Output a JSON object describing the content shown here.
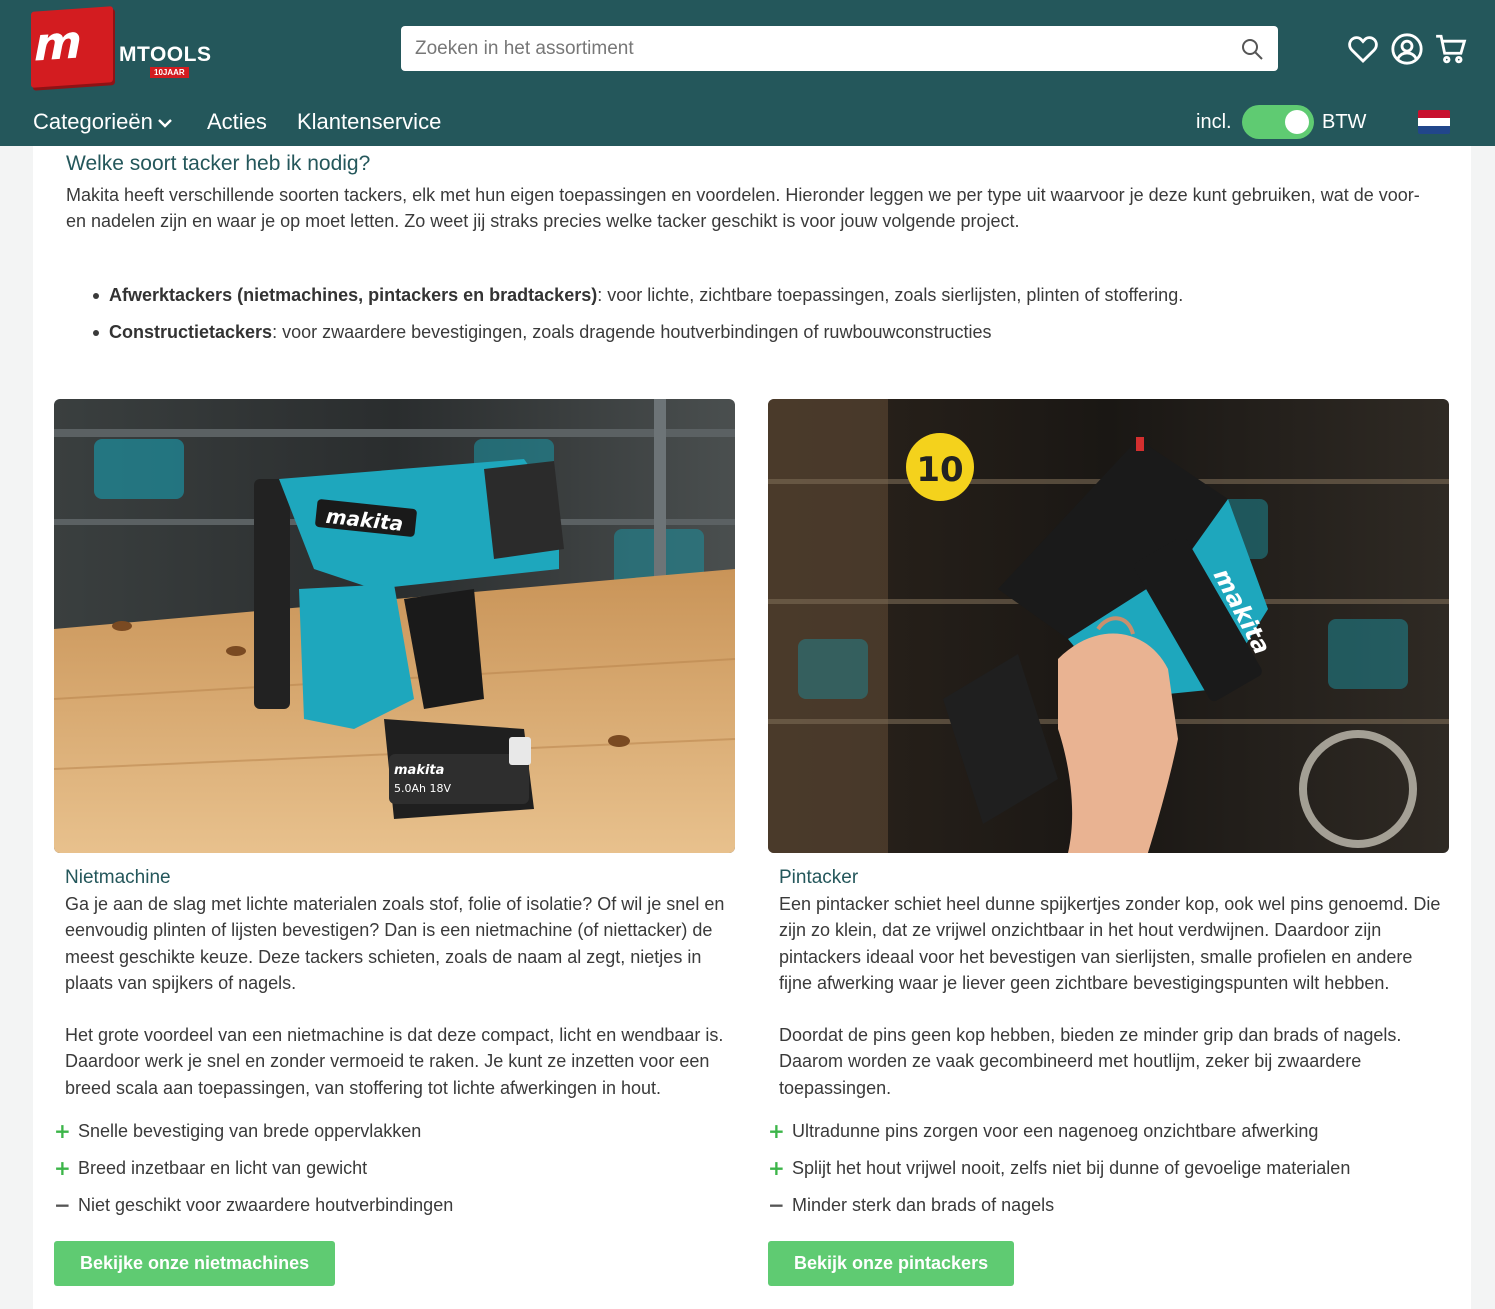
{
  "header": {
    "logo_name": "MTOOLS",
    "logo_badge": "10JAAR",
    "search_placeholder": "Zoeken in het assortiment",
    "icons": [
      "heart-icon",
      "account-icon",
      "cart-icon"
    ],
    "nav": {
      "categories": "Categorieën",
      "deals": "Acties",
      "service": "Klantenservice"
    },
    "vat": {
      "incl_label": "incl.",
      "btw_label": "BTW",
      "enabled": true
    },
    "language_flag": "nl-flag"
  },
  "colors": {
    "header_bg": "#24575b",
    "accent_green": "#5fcb72",
    "title_teal": "#24575b",
    "logo_red": "#d31c20"
  },
  "content": {
    "title": "Welke soort tacker heb ik nodig?",
    "intro": "Makita heeft verschillende soorten tackers, elk met hun eigen toepassingen en voordelen. Hieronder leggen we per type uit waarvoor je deze kunt gebruiken, wat de voor- en nadelen zijn en waar je op moet letten. Zo weet jij straks precies welke tacker geschikt is voor jouw volgende project.",
    "bullets": [
      {
        "term": "Afwerktackers (nietmachines, pintackers en bradtackers)",
        "text": ": voor lichte, zichtbare toepassingen, zoals sierlijsten, plinten of stoffering."
      },
      {
        "term": "Constructietackers",
        "text": ": voor zwaardere bevestigingen, zoals dragende houtverbindingen of ruwbouwconstructies"
      }
    ],
    "columns": [
      {
        "title": "Nietmachine",
        "paragraphs": [
          "Ga je aan de slag met lichte materialen zoals stof, folie of isolatie? Of wil je snel en eenvoudig plinten of lijsten bevestigen? Dan is een nietmachine (of niettacker) de meest geschikte keuze. Deze tackers schieten, zoals de naam al zegt, nietjes in plaats van spijkers of nagels.",
          "Het grote voordeel van een nietmachine  is dat deze compact, licht en wendbaar is. Daardoor werk je snel en zonder vermoeid te raken. Je kunt ze inzetten voor een breed scala aan toepassingen, van stoffering tot lichte afwerkingen in hout."
        ],
        "pros_cons": [
          {
            "sign": "+",
            "kind": "plus",
            "text": "Snelle bevestiging van brede oppervlakken"
          },
          {
            "sign": "+",
            "kind": "plus",
            "text": "Breed inzetbaar en licht van gewicht"
          },
          {
            "sign": "−",
            "kind": "minus",
            "text": "Niet geschikt voor zwaardere houtverbindingen"
          }
        ],
        "button": "Bekijke onze nietmachines",
        "photo_brand": "makita",
        "photo_battery": "18V"
      },
      {
        "title": "Pintacker",
        "paragraphs": [
          "Een pintacker schiet heel dunne spijkertjes zonder kop, ook wel pins genoemd. Die zijn zo klein, dat ze vrijwel onzichtbaar in het hout verdwijnen. Daardoor zijn pintackers ideaal voor het bevestigen van sierlijsten, smalle profielen en andere fijne afwerking waar je liever geen zichtbare bevestigingspunten wilt hebben.",
          "Doordat de pins geen kop hebben, bieden ze minder grip dan brads of nagels. Daarom worden ze vaak gecombineerd met houtlijm, zeker bij zwaardere toepassingen."
        ],
        "pros_cons": [
          {
            "sign": "+",
            "kind": "plus",
            "text": "Ultradunne pins zorgen voor een nagenoeg onzichtbare afwerking"
          },
          {
            "sign": "+",
            "kind": "plus",
            "text": "Splijt het hout vrijwel nooit, zelfs niet bij dunne of gevoelige materialen"
          },
          {
            "sign": "−",
            "kind": "minus",
            "text": "Minder sterk dan brads of nagels"
          }
        ],
        "button": "Bekijk onze pintackers",
        "photo_brand": "makita",
        "photo_sticker": "10"
      }
    ]
  }
}
